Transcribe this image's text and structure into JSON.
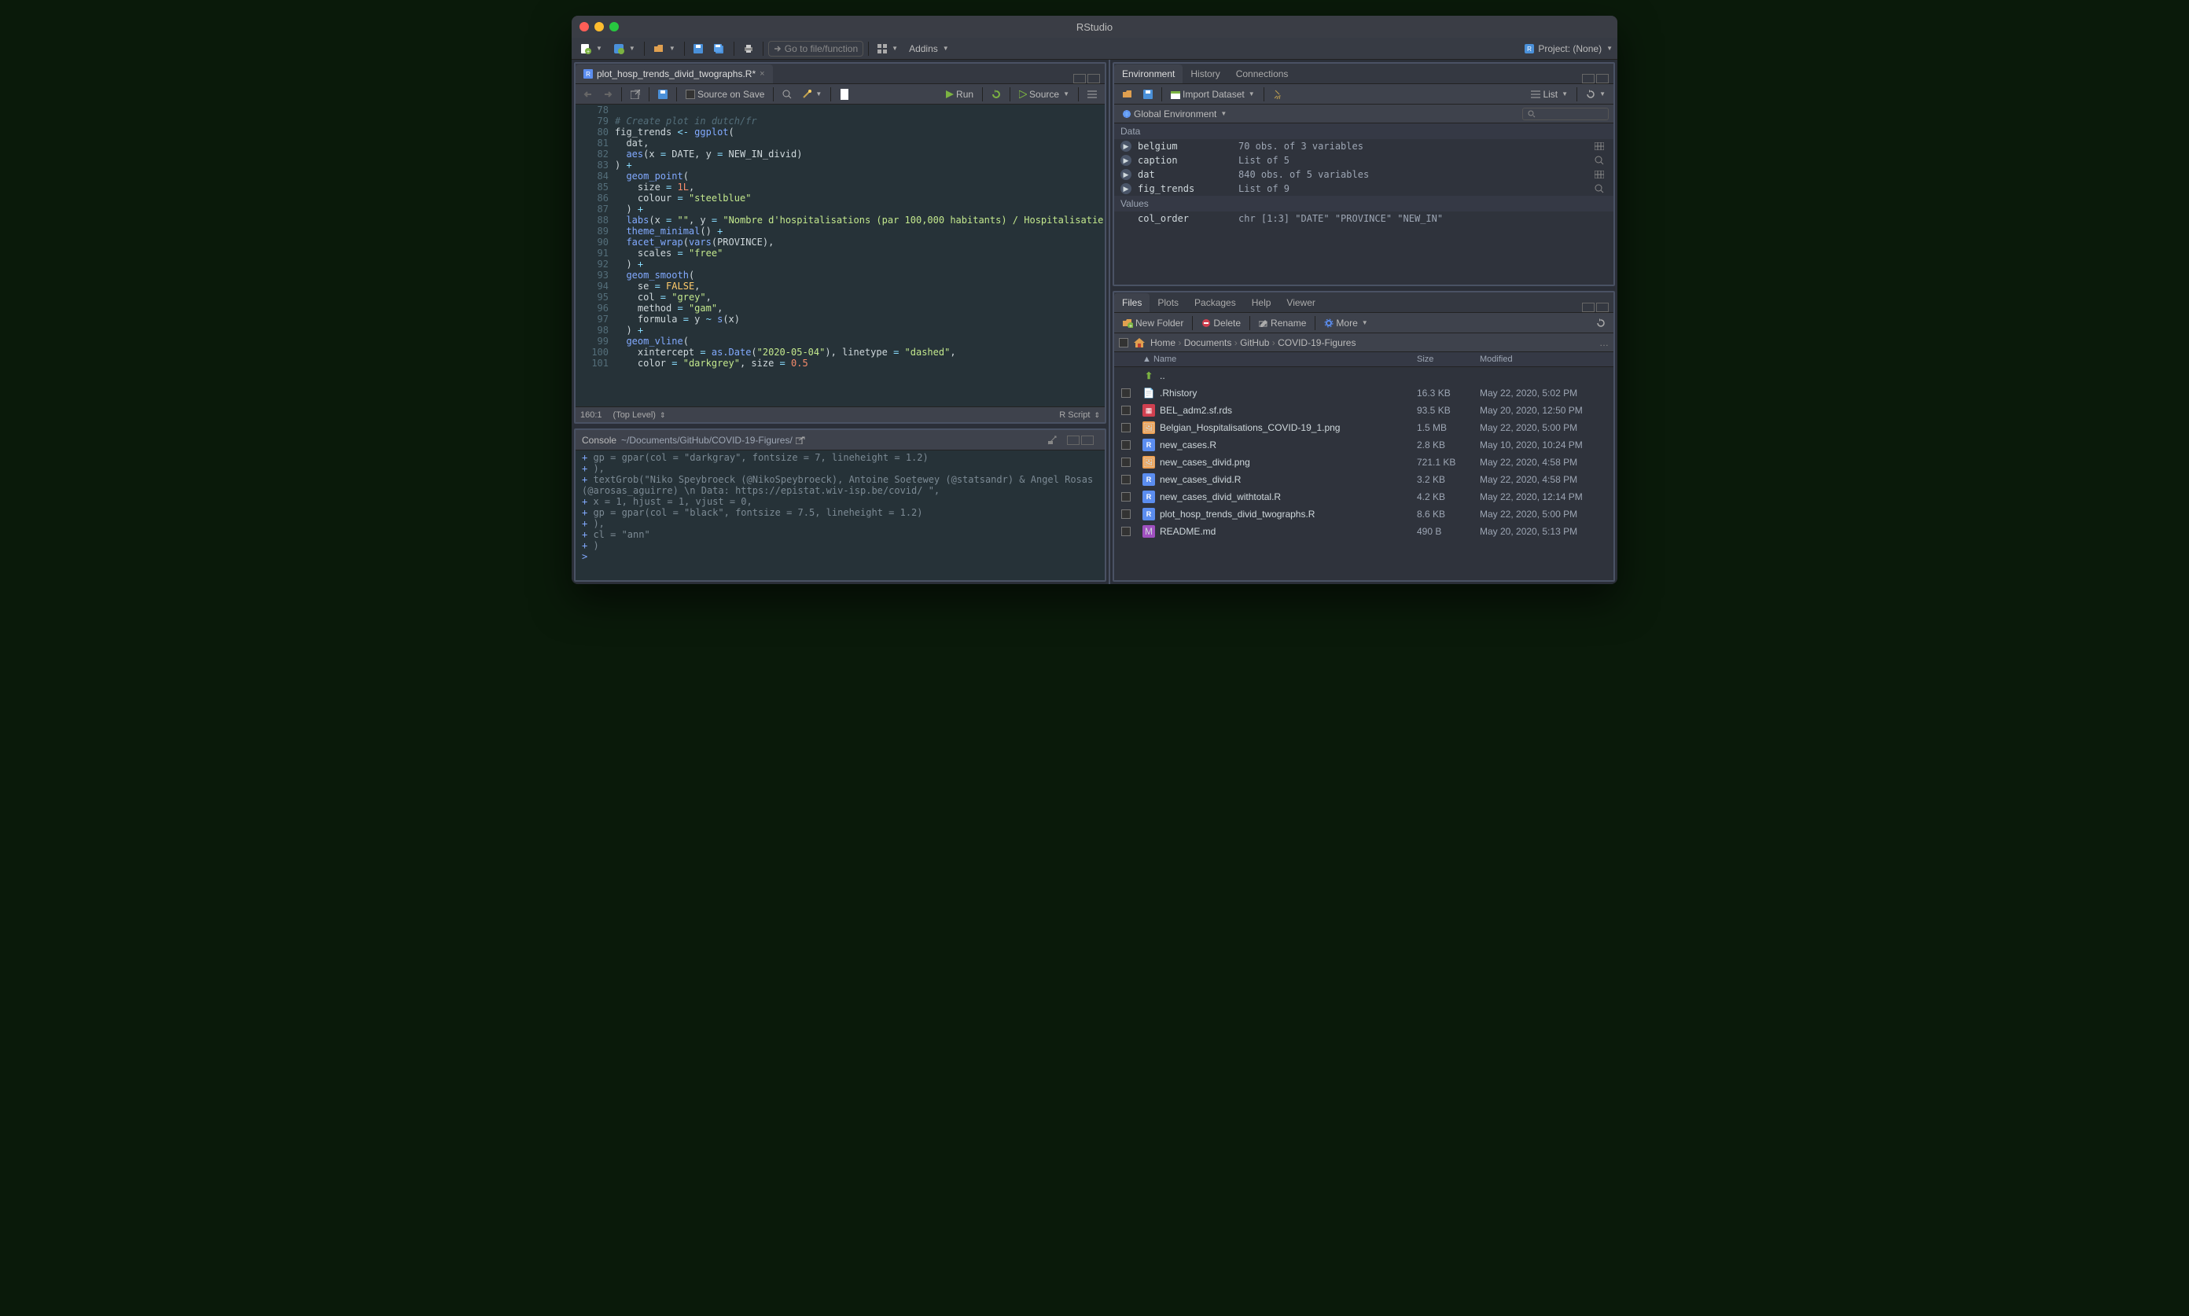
{
  "window_title": "RStudio",
  "main_toolbar": {
    "goto_placeholder": "Go to file/function",
    "addins_label": "Addins",
    "project_label": "Project: (None)"
  },
  "source": {
    "tab_filename": "plot_hosp_trends_divid_twographs.R*",
    "source_on_save": "Source on Save",
    "run_label": "Run",
    "source_label": "Source",
    "status_pos": "160:1",
    "status_scope": "(Top Level)",
    "status_type": "R Script",
    "lines": [
      {
        "n": "78",
        "html": ""
      },
      {
        "n": "79",
        "html": "<span class='c-comment'># Create plot in dutch/fr</span>"
      },
      {
        "n": "80",
        "html": "fig_trends <span class='c-op'>&lt;-</span> <span class='c-fn'>ggplot</span>("
      },
      {
        "n": "81",
        "html": "  dat,"
      },
      {
        "n": "82",
        "html": "  <span class='c-fn'>aes</span>(x <span class='c-op'>=</span> DATE, y <span class='c-op'>=</span> NEW_IN_divid)"
      },
      {
        "n": "83",
        "html": ") <span class='c-op'>+</span>"
      },
      {
        "n": "84",
        "html": "  <span class='c-fn'>geom_point</span>("
      },
      {
        "n": "85",
        "html": "    size <span class='c-op'>=</span> <span class='c-num'>1L</span>,"
      },
      {
        "n": "86",
        "html": "    colour <span class='c-op'>=</span> <span class='c-str'>\"steelblue\"</span>"
      },
      {
        "n": "87",
        "html": "  ) <span class='c-op'>+</span>"
      },
      {
        "n": "88",
        "html": "  <span class='c-fn'>labs</span>(x <span class='c-op'>=</span> <span class='c-str'>\"\"</span>, y <span class='c-op'>=</span> <span class='c-str'>\"Nombre d'hospitalisations (par 100,000 habitants) / Hospitalisatie</span>"
      },
      {
        "n": "89",
        "html": "  <span class='c-fn'>theme_minimal</span>() <span class='c-op'>+</span>"
      },
      {
        "n": "90",
        "html": "  <span class='c-fn'>facet_wrap</span>(<span class='c-fn'>vars</span>(PROVINCE),"
      },
      {
        "n": "91",
        "html": "    scales <span class='c-op'>=</span> <span class='c-str'>\"free\"</span>"
      },
      {
        "n": "92",
        "html": "  ) <span class='c-op'>+</span>"
      },
      {
        "n": "93",
        "html": "  <span class='c-fn'>geom_smooth</span>("
      },
      {
        "n": "94",
        "html": "    se <span class='c-op'>=</span> <span class='c-const'>FALSE</span>,"
      },
      {
        "n": "95",
        "html": "    col <span class='c-op'>=</span> <span class='c-str'>\"grey\"</span>,"
      },
      {
        "n": "96",
        "html": "    method <span class='c-op'>=</span> <span class='c-str'>\"gam\"</span>,"
      },
      {
        "n": "97",
        "html": "    formula <span class='c-op'>=</span> y <span class='c-op'>~</span> <span class='c-fn'>s</span>(x)"
      },
      {
        "n": "98",
        "html": "  ) <span class='c-op'>+</span>"
      },
      {
        "n": "99",
        "html": "  <span class='c-fn'>geom_vline</span>("
      },
      {
        "n": "100",
        "html": "    xintercept <span class='c-op'>=</span> <span class='c-fn'>as.Date</span>(<span class='c-str'>\"2020-05-04\"</span>), linetype <span class='c-op'>=</span> <span class='c-str'>\"dashed\"</span>,"
      },
      {
        "n": "101",
        "html": "    color <span class='c-op'>=</span> <span class='c-str'>\"darkgrey\"</span>, size <span class='c-op'>=</span> <span class='c-num'>0.5</span>"
      }
    ]
  },
  "console": {
    "title_prefix": "Console",
    "path": "~/Documents/GitHub/COVID-19-Figures/",
    "lines": [
      "+     gp = gpar(col = \"darkgray\", fontsize = 7, lineheight = 1.2)",
      "+   ),",
      "+   textGrob(\"Niko Speybroeck (@NikoSpeybroeck), Antoine Soetewey (@statsandr) & Angel Rosas (@arosas_aguirre) \\n Data: https://epistat.wiv-isp.be/covid/  \",",
      "+     x = 1, hjust = 1, vjust = 0,",
      "+     gp = gpar(col = \"black\", fontsize = 7.5, lineheight = 1.2)",
      "+   ),",
      "+   cl = \"ann\"",
      "+ )",
      "> "
    ]
  },
  "env_panel": {
    "tabs": [
      "Environment",
      "History",
      "Connections"
    ],
    "import_label": "Import Dataset",
    "view_label": "List",
    "scope_label": "Global Environment",
    "sections": {
      "Data": [
        {
          "name": "belgium",
          "val": "70 obs. of 3 variables",
          "act": "grid"
        },
        {
          "name": "caption",
          "val": "List of 5",
          "act": "search"
        },
        {
          "name": "dat",
          "val": "840 obs. of 5 variables",
          "act": "grid"
        },
        {
          "name": "fig_trends",
          "val": "List of 9",
          "act": "search"
        }
      ],
      "Values": [
        {
          "name": "col_order",
          "val": "chr [1:3] \"DATE\" \"PROVINCE\" \"NEW_IN\""
        }
      ]
    }
  },
  "files_panel": {
    "tabs": [
      "Files",
      "Plots",
      "Packages",
      "Help",
      "Viewer"
    ],
    "new_folder": "New Folder",
    "delete": "Delete",
    "rename": "Rename",
    "more": "More",
    "breadcrumb": [
      "Home",
      "Documents",
      "GitHub",
      "COVID-19-Figures"
    ],
    "cols": {
      "name": "Name",
      "size": "Size",
      "mod": "Modified"
    },
    "up_label": "..",
    "rows": [
      {
        "icon": "txt",
        "name": ".Rhistory",
        "size": "16.3 KB",
        "mod": "May 22, 2020, 5:02 PM"
      },
      {
        "icon": "data",
        "name": "BEL_adm2.sf.rds",
        "size": "93.5 KB",
        "mod": "May 20, 2020, 12:50 PM"
      },
      {
        "icon": "img",
        "name": "Belgian_Hospitalisations_COVID-19_1.png",
        "size": "1.5 MB",
        "mod": "May 22, 2020, 5:00 PM"
      },
      {
        "icon": "r",
        "name": "new_cases.R",
        "size": "2.8 KB",
        "mod": "May 10, 2020, 10:24 PM"
      },
      {
        "icon": "img",
        "name": "new_cases_divid.png",
        "size": "721.1 KB",
        "mod": "May 22, 2020, 4:58 PM"
      },
      {
        "icon": "r",
        "name": "new_cases_divid.R",
        "size": "3.2 KB",
        "mod": "May 22, 2020, 4:58 PM"
      },
      {
        "icon": "r",
        "name": "new_cases_divid_withtotal.R",
        "size": "4.2 KB",
        "mod": "May 22, 2020, 12:14 PM"
      },
      {
        "icon": "r",
        "name": "plot_hosp_trends_divid_twographs.R",
        "size": "8.6 KB",
        "mod": "May 22, 2020, 5:00 PM"
      },
      {
        "icon": "md",
        "name": "README.md",
        "size": "490 B",
        "mod": "May 20, 2020, 5:13 PM"
      }
    ]
  }
}
